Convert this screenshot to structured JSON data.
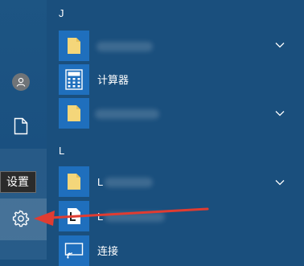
{
  "start_menu": {
    "left_rail": {
      "avatar_icon": "user-avatar-icon",
      "documents_icon": "document-icon",
      "settings_icon": "gear-icon",
      "settings_tooltip": "设置"
    },
    "app_list": {
      "group_j": "J",
      "group_l": "L",
      "items": [
        {
          "label": "",
          "icon": "folder-icon",
          "expandable": true
        },
        {
          "label": "计算器",
          "icon": "calculator-icon",
          "expandable": false
        },
        {
          "label": "",
          "icon": "folder-icon",
          "expandable": true
        },
        {
          "label": "L",
          "icon": "folder-icon",
          "expandable": true
        },
        {
          "label": "L",
          "icon": "document-icon",
          "expandable": false
        },
        {
          "label": "连接",
          "icon": "connect-icon",
          "expandable": false
        }
      ]
    }
  },
  "colors": {
    "background": "#1a4f7d",
    "tile": "#1f6fbd",
    "folder": "#f4d67a",
    "annotation_arrow": "#e03c31"
  }
}
